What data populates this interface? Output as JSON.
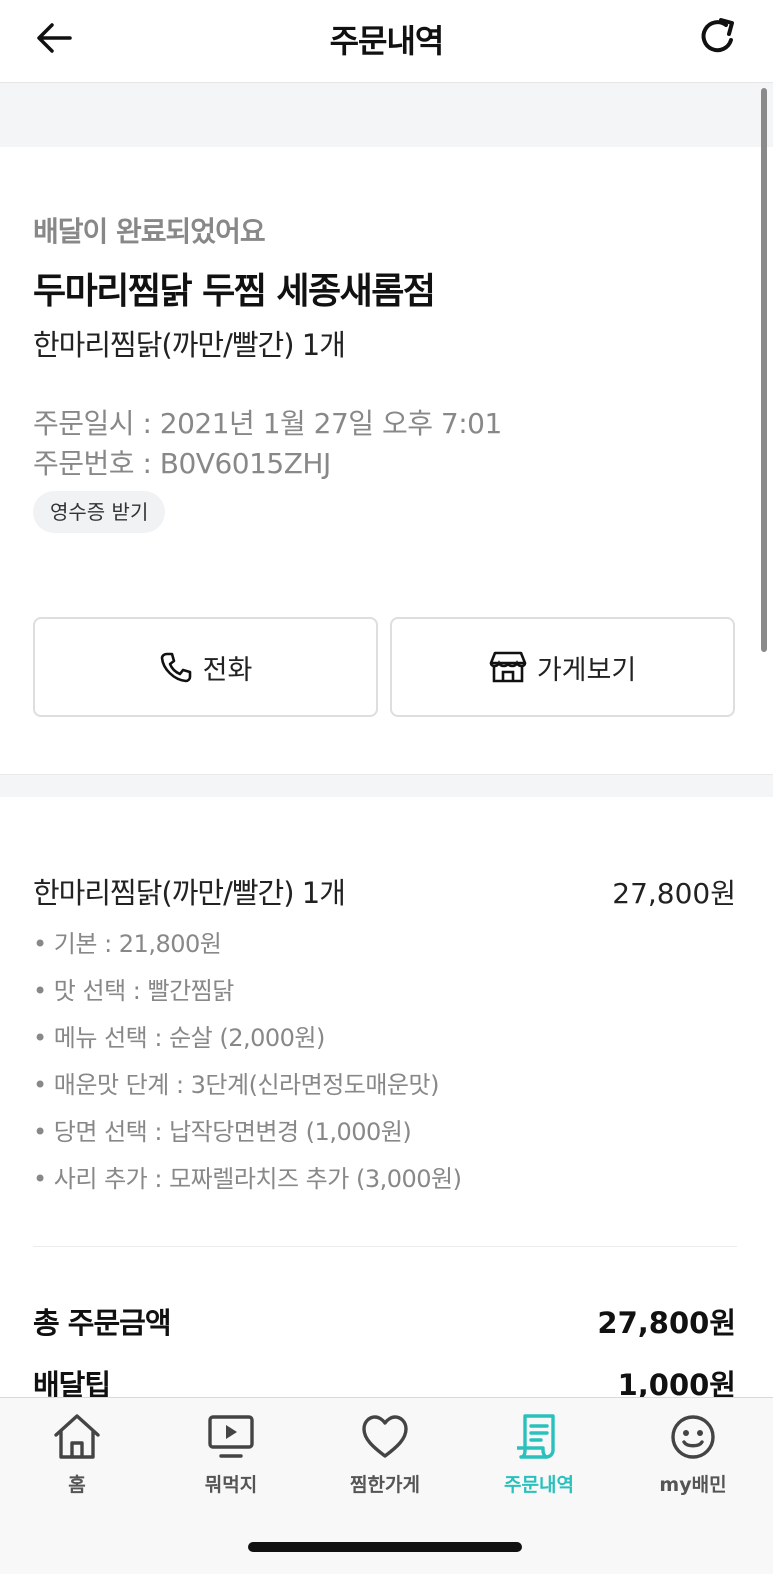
{
  "header": {
    "title": "주문내역"
  },
  "order": {
    "status": "배달이 완료되었어요",
    "store_name": "두마리찜닭 두찜 세종새롬점",
    "summary": "한마리찜닭(까만/빨간) 1개",
    "date": "주문일시 : 2021년 1월 27일 오후 7:01",
    "number": "주문번호 : B0V6015ZHJ",
    "receipt_label": "영수증 받기"
  },
  "actions": {
    "call_label": "전화",
    "store_label": "가게보기"
  },
  "item": {
    "name": "한마리찜닭(까만/빨간) 1개",
    "price": "27,800원",
    "options": [
      "• 기본 : 21,800원",
      "• 맛 선택 : 빨간찜닭",
      "• 메뉴 선택 : 순살 (2,000원)",
      "• 매운맛 단계 : 3단계(신라면정도매운맛)",
      "• 당면 선택 : 납작당면변경 (1,000원)",
      "• 사리 추가 : 모짜렐라치즈 추가 (3,000원)"
    ]
  },
  "totals": {
    "total_label": "총 주문금액",
    "total_value": "27,800원",
    "tip_label": "배달팁",
    "tip_value": "1,000원"
  },
  "tabs": [
    {
      "label": "홈",
      "icon": "home-icon"
    },
    {
      "label": "뭐먹지",
      "icon": "play-icon"
    },
    {
      "label": "찜한가게",
      "icon": "heart-icon"
    },
    {
      "label": "주문내역",
      "icon": "receipt-icon",
      "active": true
    },
    {
      "label": "my배민",
      "icon": "smile-icon"
    }
  ],
  "colors": {
    "accent": "#2ac1bc",
    "muted_text": "#888888",
    "background_band": "#f4f5f7"
  }
}
